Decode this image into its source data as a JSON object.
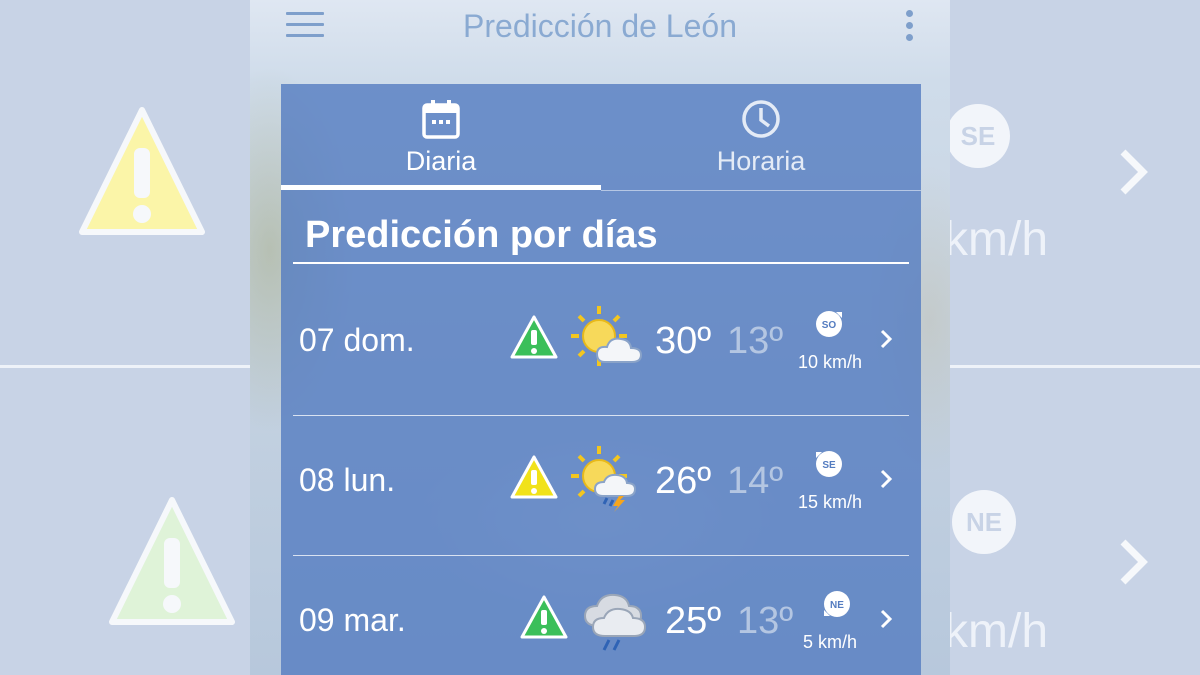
{
  "app": {
    "title": "Predicción de León"
  },
  "tabs": [
    {
      "label": "Diaria",
      "icon": "calendar-icon",
      "active": true
    },
    {
      "label": "Horaria",
      "icon": "clock-icon",
      "active": false
    }
  ],
  "section": {
    "title": "Predicción por días"
  },
  "days": [
    {
      "label": "07 dom.",
      "warning_color": "#3bbf5a",
      "weather_icon": "sun-cloud-icon",
      "max": "30º",
      "min": "13º",
      "wind_dir": "SO",
      "wind_speed": "10 km/h"
    },
    {
      "label": "08 lun.",
      "warning_color": "#f1e21a",
      "weather_icon": "sun-cloud-storm-icon",
      "max": "26º",
      "min": "14º",
      "wind_dir": "SE",
      "wind_speed": "15 km/h"
    },
    {
      "label": "09 mar.",
      "warning_color": "#3bbf5a",
      "weather_icon": "cloud-rain-icon",
      "max": "25º",
      "min": "13º",
      "wind_dir": "NE",
      "wind_speed": "5 km/h"
    }
  ],
  "background": {
    "right_wind_top": "SE",
    "right_wind_bottom": "NE",
    "unit_text": "km/h"
  },
  "colors": {
    "panel": "#547cc0",
    "accent": "#7e9fcb",
    "warning_green": "#3bbf5a",
    "warning_yellow": "#f1e21a"
  }
}
